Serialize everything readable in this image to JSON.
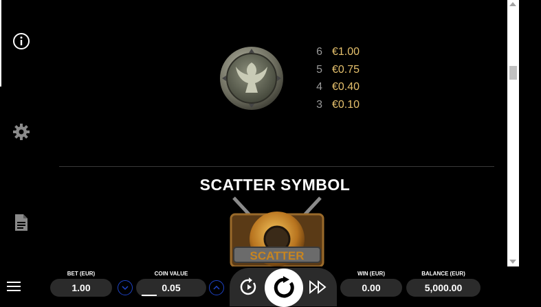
{
  "sidebar": {
    "info_icon": "info-icon",
    "settings_icon": "gear-icon",
    "rules_icon": "document-icon"
  },
  "paytable": {
    "rows": [
      {
        "count": "6",
        "value": "€1.00"
      },
      {
        "count": "5",
        "value": "€0.75"
      },
      {
        "count": "4",
        "value": "€0.40"
      },
      {
        "count": "3",
        "value": "€0.10"
      }
    ]
  },
  "scatter": {
    "title": "SCATTER SYMBOL",
    "image_text": "SCATTER"
  },
  "bottom_bar": {
    "bet_label": "BET (EUR)",
    "bet_value": "1.00",
    "coin_label": "COIN VALUE",
    "coin_value": "0.05",
    "win_label": "WIN (EUR)",
    "win_value": "0.00",
    "balance_label": "BALANCE (EUR)",
    "balance_value": "5,000.00"
  },
  "colors": {
    "accent_blue": "#1e44c8",
    "gold": "#e6c16d",
    "pill_bg": "#2b2b2b"
  }
}
